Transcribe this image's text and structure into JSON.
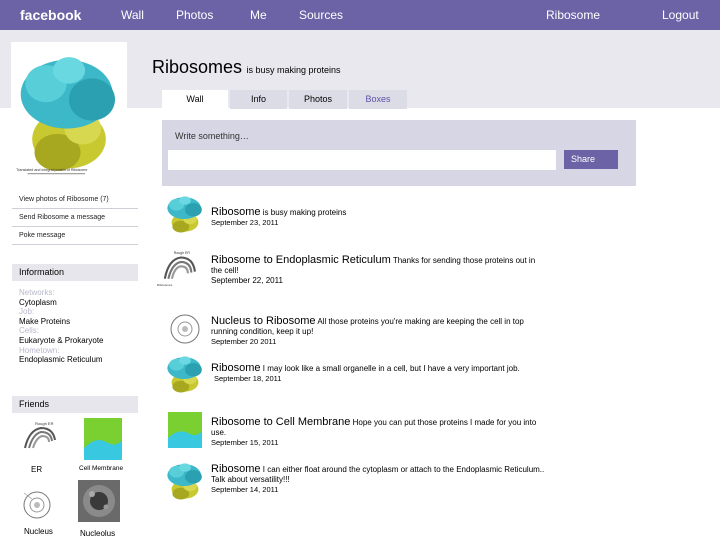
{
  "nav": {
    "brand": "facebook",
    "wall": "Wall",
    "photos": "Photos",
    "me": "Me",
    "sources": "Sources",
    "profile_name": "Ribosome",
    "logout": "Logout"
  },
  "profile_photo_caption": "Translated and integral protein of Ribosome",
  "left_links": [
    "View photos of Ribosome (7)",
    "Send Ribosome a message",
    "Poke message"
  ],
  "information": {
    "heading": "Information",
    "fields": [
      {
        "label": "Networks:",
        "value": "Cytoplasm"
      },
      {
        "label": "Job:",
        "value": "Make Proteins"
      },
      {
        "label": "Cells:",
        "value": "Eukaryote & Prokaryote"
      },
      {
        "label": "Hometown:",
        "value": "Endoplasmic Reticulum"
      }
    ]
  },
  "friends": {
    "heading": "Friends",
    "items": [
      "ER",
      "Cell Membrane",
      "Nucleus",
      "Nucleolus"
    ],
    "er_image_label": "Rough ER"
  },
  "header": {
    "name": "Ribosomes",
    "status": "is busy making proteins"
  },
  "tabs": [
    "Wall",
    "Info",
    "Photos",
    "Boxes"
  ],
  "composer": {
    "placeholder": "Write something…",
    "share": "Share"
  },
  "posts": [
    {
      "author": "Ribosome",
      "text": "is busy making proteins",
      "date": "September 23, 2011"
    },
    {
      "author": "Ribosome to Endoplasmic Reticulum",
      "text": "Thanks for sending those proteins out in the cell!",
      "date": "September 22, 2011",
      "img_label_top": "Rough ER",
      "img_label_bottom": "Ribosomes"
    },
    {
      "author": "Nucleus to Ribosome",
      "text": "All those proteins you're making are keeping the cell in top running condition, keep it up!",
      "date": "September 20 2011"
    },
    {
      "author": "Ribosome",
      "text": "I may look like a small organelle in a cell, but I have a very important job.",
      "date": "September 18, 2011"
    },
    {
      "author": "Ribosome to Cell Membrane",
      "text": "Hope you can put those proteins I made for you into use.",
      "date": "September 15, 2011"
    },
    {
      "author": "Ribosome",
      "text": "I can either float around the cytoplasm or attach to the Endoplasmic Reticulum.. Talk about versatility!!!",
      "date": "September 14, 2011"
    }
  ],
  "colors": {
    "nav": "#6b63a6",
    "band": "#e8e8ee",
    "composer": "#d6d6e4",
    "ribosome_teal": "#3cb8c8",
    "ribosome_yellow": "#c8c830",
    "membrane_green": "#7ad030"
  }
}
